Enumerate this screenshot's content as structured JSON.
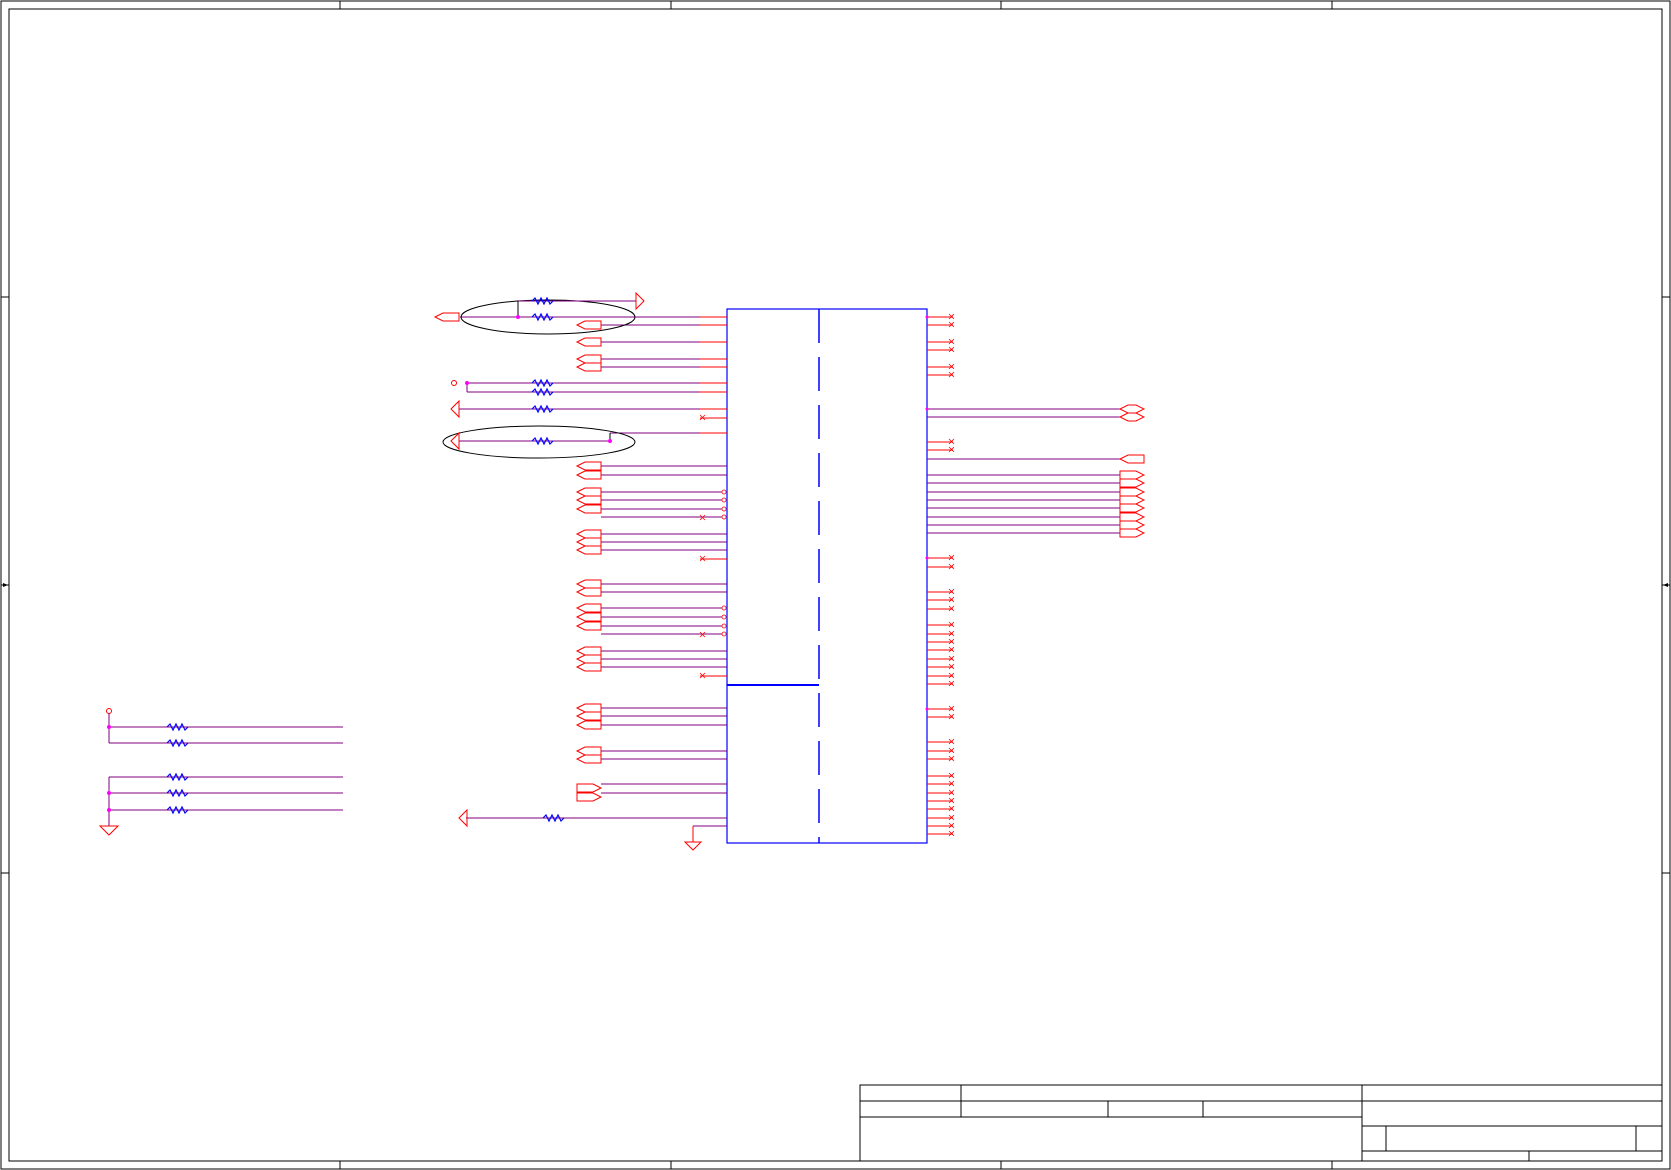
{
  "document": {
    "kind": "schematic-sheet",
    "text_labels": []
  },
  "colors": {
    "frame": "#000000",
    "wire": "#ff0000",
    "net": "#800080",
    "component": "#0000ff",
    "junction": "#ff00ff"
  },
  "title_block": {
    "cells": [
      "",
      "",
      "",
      "",
      "",
      "",
      "",
      "",
      ""
    ]
  }
}
